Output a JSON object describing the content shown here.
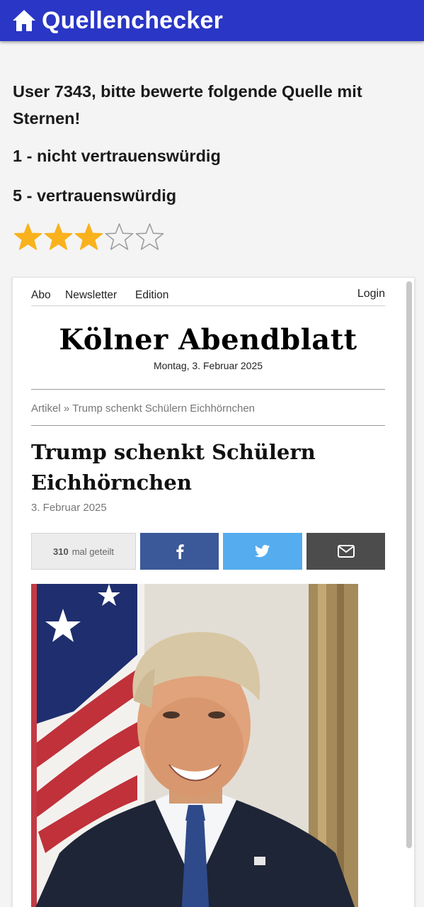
{
  "appbar": {
    "title": "Quellenchecker",
    "home_icon": "home-icon",
    "color": "#2a36c5"
  },
  "rating": {
    "prompt": "User 7343, bitte bewerte folgende Quelle mit Sternen!",
    "scale_low": "1 - nicht vertrauenswürdig",
    "scale_high": "5 - vertrauenswürdig",
    "value": 3,
    "max": 5,
    "star_color": "#f9b21d"
  },
  "site": {
    "nav": {
      "abo": "Abo",
      "newsletter": "Newsletter",
      "edition": "Edition",
      "login": "Login"
    },
    "masthead": "Kölner Abendblatt",
    "date": "Montag, 3. Februar 2025",
    "breadcrumb": {
      "root": "Artikel",
      "separator": "»",
      "current": "Trump schenkt Schülern Eichhörnchen"
    }
  },
  "article": {
    "headline": "Trump schenkt Schülern Eichhörnchen",
    "date": "3. Februar 2025",
    "share": {
      "count": "310",
      "count_label": "mal geteilt",
      "facebook_icon": "facebook-icon",
      "twitter_icon": "twitter-icon",
      "email_icon": "email-icon",
      "colors": {
        "facebook": "#3b5998",
        "twitter": "#55acee",
        "email": "#4c4c4c"
      }
    },
    "image": "portrait-photo"
  }
}
